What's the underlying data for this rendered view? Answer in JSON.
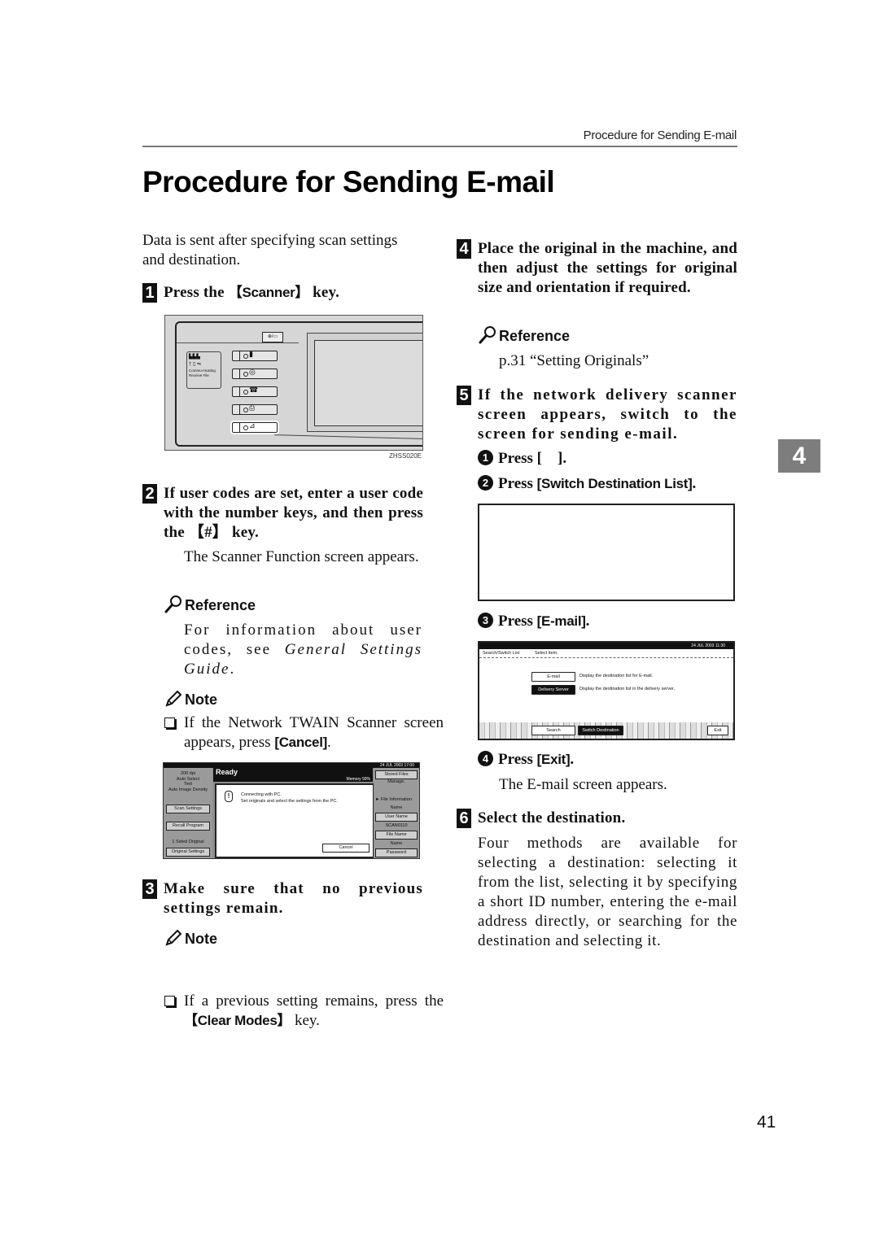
{
  "running_head": "Procedure for Sending E-mail",
  "title": "Procedure for Sending E-mail",
  "intro": "Data is sent after specifying scan settings and destination.",
  "chapter_tab": "4",
  "page_number": "41",
  "steps": [
    {
      "num": "1",
      "text_pre": "Press the ",
      "key": "【Scanner】",
      "text_post": " key.",
      "figure": {
        "caption": "ZHSS020E",
        "indicator_labels": [
          "Commu-nicating",
          "Receive File"
        ]
      }
    },
    {
      "num": "2",
      "text_pre": "If user codes are set, enter a user code with the number keys, and then press the ",
      "key": "【#】",
      "text_post": " key.",
      "body": "The Scanner Function screen appears.",
      "reference": {
        "heading": "Reference",
        "text_pre": "For information about user codes, see ",
        "text_italic": "General Settings Guide",
        "text_post": "."
      },
      "note": {
        "heading": "Note",
        "item_pre": "If the Network TWAIN Scanner screen appears, press ",
        "item_key": "[Cancel]",
        "item_post": "."
      },
      "screen": {
        "datetime": "24  JUL  2003 17:00",
        "status": "Ready",
        "memory": "Memory 99%",
        "left_info": [
          "200 dpi",
          "Auto Select",
          "Text",
          "Auto Image Density"
        ],
        "left_buttons": [
          "Scan Settings",
          "Recall Program"
        ],
        "left_footer": "1 Sided Original",
        "left_footer_button": "Original Settings",
        "dialog_lines": [
          "Connecting with PC.",
          "Set originals and select the settings from the PC."
        ],
        "dialog_button": "Cancel",
        "right_top_button": "Stored Files Manage.",
        "right_section": "► File Information",
        "right_items": [
          {
            "label": "Name",
            "button": "User Name"
          },
          {
            "label": "SCAN0110",
            "button": "File Name"
          },
          {
            "label": "Name",
            "button": "Password"
          }
        ]
      }
    },
    {
      "num": "3",
      "text": "Make sure that no previous settings remain.",
      "note": {
        "heading": "Note",
        "item_pre": "If a previous setting remains, press the ",
        "item_key": "【Clear Modes】",
        "item_post": " key."
      }
    },
    {
      "num": "4",
      "text": "Place the original in the machine, and then adjust the settings for original size and orientation if required.",
      "reference": {
        "heading": "Reference",
        "text": "p.31 “Setting Originals”"
      }
    },
    {
      "num": "5",
      "text": "If the network delivery scanner screen appears, switch to the screen for sending e-mail.",
      "substeps": [
        {
          "num": "1",
          "text_pre": "Press [",
          "key": "    ",
          "text_post": "]."
        },
        {
          "num": "2",
          "text_pre": "Press ",
          "key": "[Switch Destination List]",
          "text_post": "."
        },
        {
          "num": "3",
          "text_pre": "Press ",
          "key": "[E-mail]",
          "text_post": "."
        },
        {
          "num": "4",
          "text_pre": "Press ",
          "key": "[Exit]",
          "text_post": ".",
          "body": "The E-mail screen appears."
        }
      ],
      "switch_screen": {
        "datetime": "24  JUL  2003 11:30",
        "header_left": "Search/Switch List",
        "header_right": "Select item.",
        "options": [
          {
            "button": "E-mail",
            "desc": "Display the destination list for E-mail.",
            "selected": false
          },
          {
            "button": "Delivery Server",
            "desc": "Display the destination list in the delivery server.",
            "selected": true
          }
        ],
        "bottom_buttons": [
          "Search",
          "Switch Destination List",
          "Exit"
        ]
      }
    },
    {
      "num": "6",
      "text": "Select the destination.",
      "body": "Four methods are available for selecting a destination: selecting it from the list, selecting it by specifying a short ID number, entering the e-mail address directly, or searching for the destination and selecting it."
    }
  ]
}
